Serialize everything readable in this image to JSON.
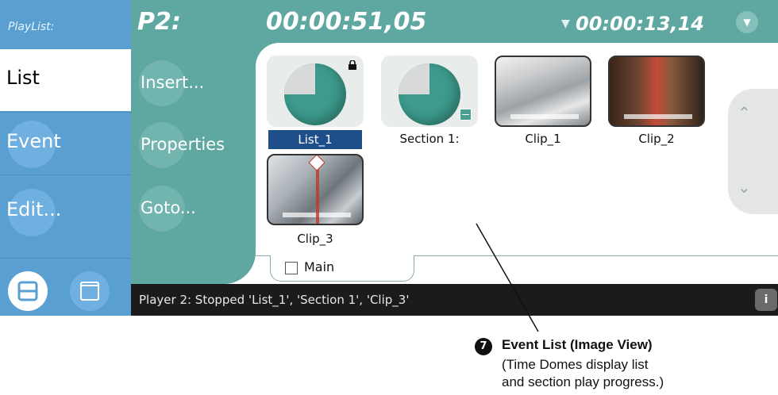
{
  "sidebar": {
    "title": "PlayList:",
    "items": [
      {
        "label": "List",
        "active": true
      },
      {
        "label": "Event",
        "active": false
      },
      {
        "label": "Edit...",
        "active": false
      }
    ]
  },
  "header": {
    "player": "P2:",
    "timecode": "00:00:51,05",
    "remaining": "00:00:13,14"
  },
  "actions": [
    "Insert...",
    "Properties",
    "Goto..."
  ],
  "events": [
    {
      "label": "List_1",
      "kind": "dome",
      "selected": true,
      "locked": true
    },
    {
      "label": "Section 1:",
      "kind": "dome",
      "selected": false,
      "section": true
    },
    {
      "label": "Clip_1",
      "kind": "clip",
      "selected": false
    },
    {
      "label": "Clip_2",
      "kind": "clip",
      "selected": false
    },
    {
      "label": "Clip_3",
      "kind": "clip",
      "selected": false
    }
  ],
  "tab": {
    "label": "Main"
  },
  "status": {
    "text": "Player 2: Stopped 'List_1', 'Section 1', 'Clip_3'"
  },
  "callout": {
    "number": "7",
    "title": "Event List (Image View)",
    "desc_line1": "(Time Domes display list",
    "desc_line2": "and section play progress.)"
  },
  "colors": {
    "sidebar": "#5a9fd2",
    "teal": "#5fa8a2",
    "selection": "#1f4f8a",
    "dome": "#3d9a8c",
    "status_bar": "#1b1b1b"
  }
}
